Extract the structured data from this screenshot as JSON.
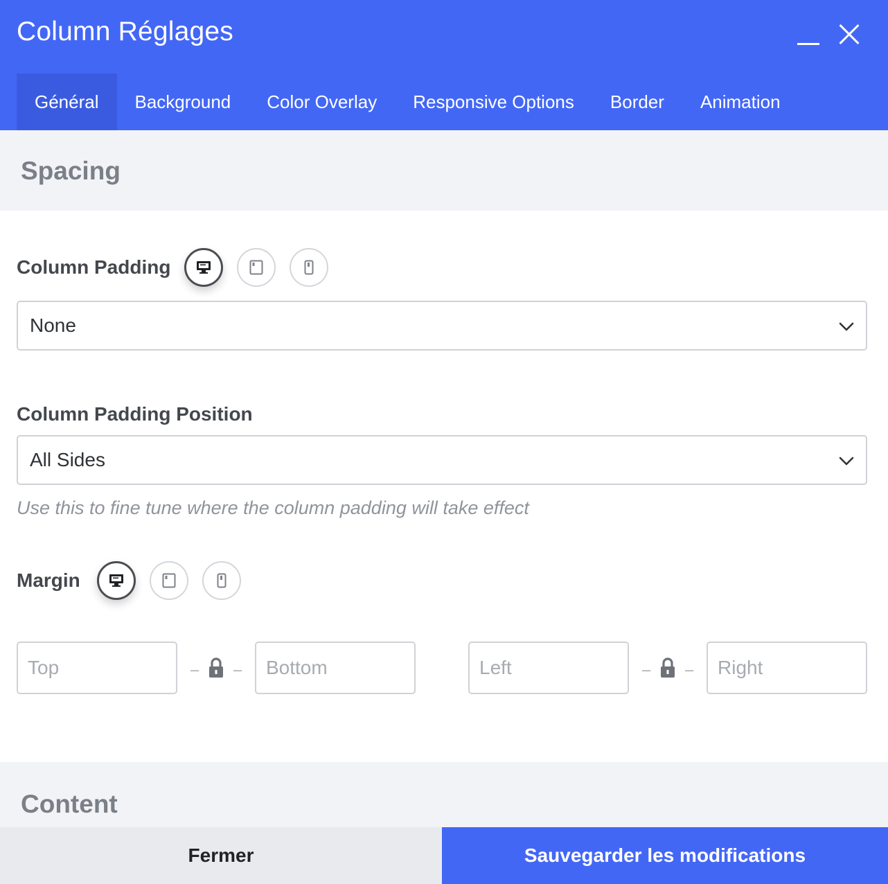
{
  "window": {
    "title": "Column Réglages",
    "minimize_icon": "minimize-icon",
    "close_icon": "close-icon"
  },
  "tabs": [
    {
      "label": "Général",
      "active": true
    },
    {
      "label": "Background",
      "active": false
    },
    {
      "label": "Color Overlay",
      "active": false
    },
    {
      "label": "Responsive Options",
      "active": false
    },
    {
      "label": "Border",
      "active": false
    },
    {
      "label": "Animation",
      "active": false
    }
  ],
  "sections": {
    "spacing": "Spacing",
    "content": "Content"
  },
  "column_padding": {
    "label": "Column Padding",
    "devices": [
      "desktop",
      "tablet",
      "mobile"
    ],
    "active_device": "desktop",
    "value": "None"
  },
  "column_padding_position": {
    "label": "Column Padding Position",
    "value": "All Sides",
    "help": "Use this to fine tune where the column padding will take effect"
  },
  "margin": {
    "label": "Margin",
    "devices": [
      "desktop",
      "tablet",
      "mobile"
    ],
    "active_device": "desktop",
    "top_placeholder": "Top",
    "bottom_placeholder": "Bottom",
    "left_placeholder": "Left",
    "right_placeholder": "Right",
    "separator": "–"
  },
  "footer": {
    "close_label": "Fermer",
    "save_label": "Sauvegarder les modifications"
  },
  "colors": {
    "primary": "#4367f5",
    "tab_active": "#3a5be0",
    "section_bg": "#f2f3f6",
    "close_bg": "#e9eaed"
  }
}
